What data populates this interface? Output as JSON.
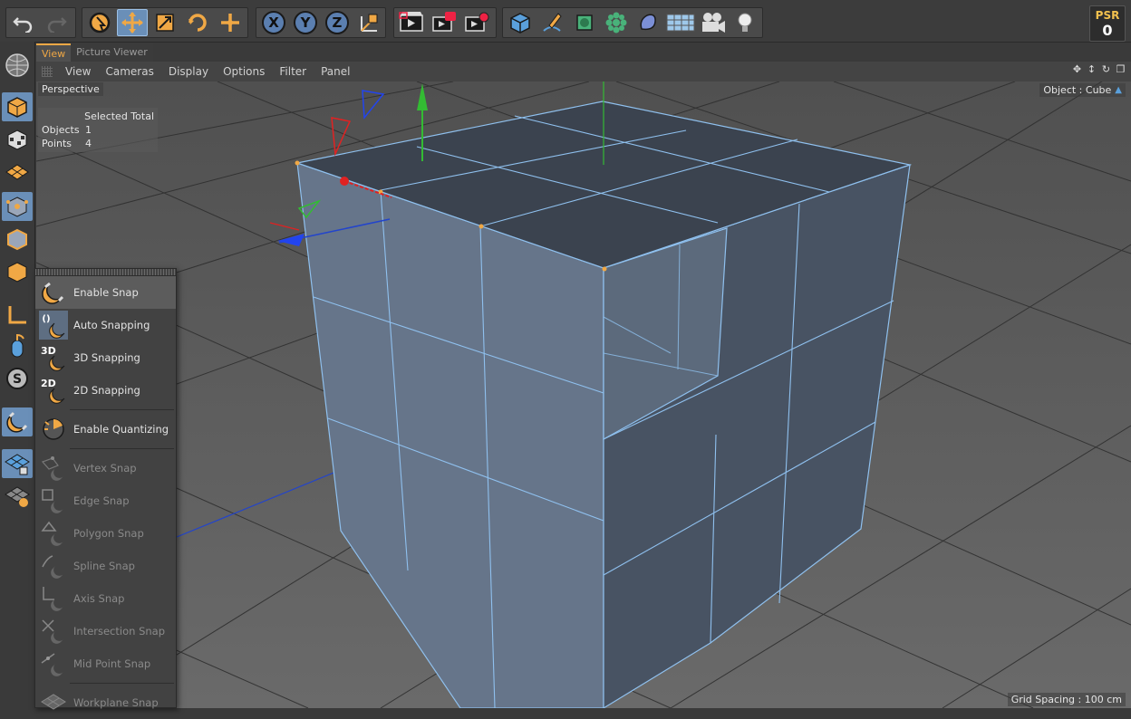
{
  "toolbar": {
    "undo_icon": "undo-icon",
    "redo_icon": "redo-icon",
    "axis_x": "X",
    "axis_y": "Y",
    "axis_z": "Z",
    "psr_label": "PSR",
    "psr_value": "0"
  },
  "tabs": [
    {
      "label": "View",
      "active": true
    },
    {
      "label": "Picture Viewer",
      "active": false
    }
  ],
  "menu": [
    "View",
    "Cameras",
    "Display",
    "Options",
    "Filter",
    "Panel"
  ],
  "viewport": {
    "camera_label": "Perspective",
    "object_label": "Object : Cube",
    "grid_spacing": "Grid Spacing : 100 cm",
    "stats": {
      "header": "Selected Total",
      "rows": [
        {
          "key": "Objects",
          "value": "1"
        },
        {
          "key": "Points",
          "value": "4"
        }
      ]
    }
  },
  "snap_menu": {
    "items": [
      {
        "label": "Enable Snap",
        "icon": "magnet-icon",
        "enabled": true,
        "highlighted": true
      },
      {
        "label": "Auto Snapping",
        "icon": "auto-snap-icon",
        "enabled": true
      },
      {
        "label": "3D Snapping",
        "icon": "snap-3d-icon",
        "enabled": true
      },
      {
        "label": "2D Snapping",
        "icon": "snap-2d-icon",
        "enabled": true
      },
      {
        "label": "Enable Quantizing",
        "icon": "quantize-icon",
        "enabled": true
      },
      {
        "label": "Vertex Snap",
        "icon": "vertex-snap-icon",
        "enabled": false
      },
      {
        "label": "Edge Snap",
        "icon": "edge-snap-icon",
        "enabled": false
      },
      {
        "label": "Polygon Snap",
        "icon": "polygon-snap-icon",
        "enabled": false
      },
      {
        "label": "Spline Snap",
        "icon": "spline-snap-icon",
        "enabled": false
      },
      {
        "label": "Axis Snap",
        "icon": "axis-snap-icon",
        "enabled": false
      },
      {
        "label": "Intersection Snap",
        "icon": "intersection-snap-icon",
        "enabled": false
      },
      {
        "label": "Mid Point Snap",
        "icon": "midpoint-snap-icon",
        "enabled": false
      },
      {
        "label": "Workplane Snap",
        "icon": "workplane-snap-icon",
        "enabled": false
      }
    ]
  },
  "colors": {
    "accent_orange": "#f0a845",
    "active_blue": "#6a8fb8",
    "edge_blue": "#7fb3e6",
    "viewport_bg": "#595959"
  }
}
